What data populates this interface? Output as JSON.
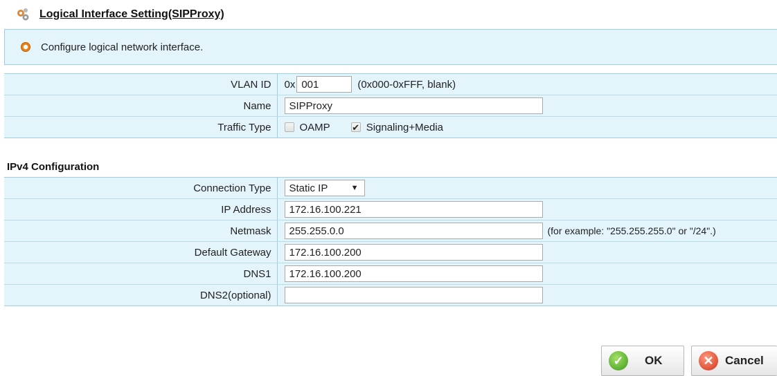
{
  "header": {
    "title": "Logical Interface Setting(SIPProxy)",
    "icon": "gears-icon"
  },
  "info": {
    "text": "Configure logical network interface.",
    "icon": "info-bullet-icon"
  },
  "interface": {
    "vlan": {
      "label": "VLAN ID",
      "prefix": "0x",
      "value": "001",
      "hint": "(0x000-0xFFF, blank)"
    },
    "name": {
      "label": "Name",
      "value": "SIPProxy"
    },
    "traffic": {
      "label": "Traffic Type",
      "oamp": {
        "label": "OAMP",
        "checked": false
      },
      "signaling": {
        "label": "Signaling+Media",
        "checked": true,
        "mark": "✔"
      }
    }
  },
  "ipv4": {
    "section_title": "IPv4 Configuration",
    "connection_type": {
      "label": "Connection Type",
      "value": "Static IP",
      "arrow": "▼"
    },
    "ip_address": {
      "label": "IP Address",
      "value": "172.16.100.221"
    },
    "netmask": {
      "label": "Netmask",
      "value": "255.255.0.0",
      "hint": "(for example: \"255.255.255.0\" or \"/24\".)"
    },
    "gateway": {
      "label": "Default Gateway",
      "value": "172.16.100.200"
    },
    "dns1": {
      "label": "DNS1",
      "value": "172.16.100.200"
    },
    "dns2": {
      "label": "DNS2(optional)",
      "value": ""
    }
  },
  "buttons": {
    "ok": {
      "label": "OK",
      "icon": "check-icon",
      "glyph": "✓",
      "color": "#3c9a19"
    },
    "cancel": {
      "label": "Cancel",
      "icon": "cancel-icon",
      "glyph": "✕",
      "color": "#d0301a"
    }
  },
  "colors": {
    "panel_bg": "#e3f4fb",
    "panel_border": "#9ccde3"
  }
}
